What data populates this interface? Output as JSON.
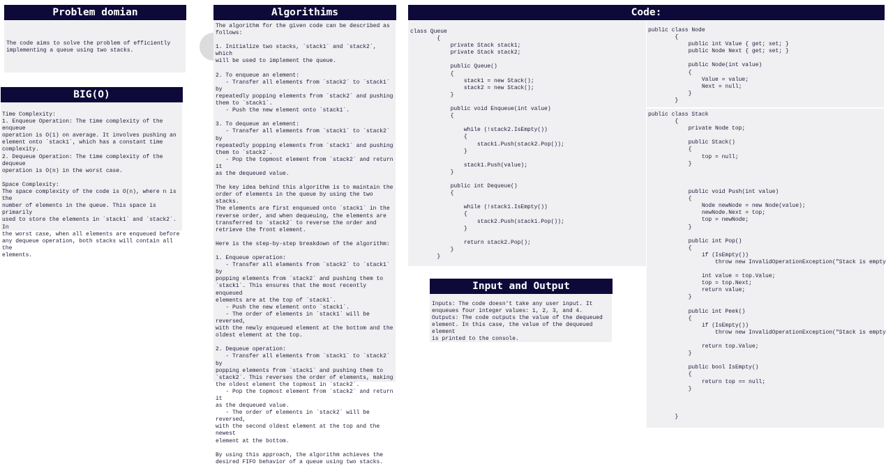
{
  "problem": {
    "title": "Problem domian",
    "body": "The code aims to solve the problem of efficiently\nimplementing a queue using two stacks."
  },
  "bigo": {
    "title": "BIG(O)",
    "body": "Time Complexity:\n1. Enqueue Operation: The time complexity of the enqueue\noperation is O(1) on average. It involves pushing an\nelement onto `stack1`, which has a constant time\ncomplexity.\n2. Dequeue Operation: The time complexity of the dequeue\noperation is O(n) in the worst case.\n\nSpace Complexity:\nThe space complexity of the code is O(n), where n is the\nnumber of elements in the queue. This space is primarily\nused to store the elements in `stack1` and `stack2`. In\nthe worst case, when all elements are enqueued before\nany dequeue operation, both stacks will contain all the\nelements."
  },
  "algorithms": {
    "title": "Algorithims",
    "body": "The algorithm for the given code can be described as\nfollows:\n\n1. Initialize two stacks, `stack1` and `stack2`, which\nwill be used to implement the queue.\n\n2. To enqueue an element:\n   - Transfer all elements from `stack2` to `stack1` by\nrepeatedly popping elements from `stack2` and pushing\nthem to `stack1`.\n   - Push the new element onto `stack1`.\n\n3. To dequeue an element:\n   - Transfer all elements from `stack1` to `stack2` by\nrepeatedly popping elements from `stack1` and pushing\nthem to `stack2`.\n   - Pop the topmost element from `stack2` and return it\nas the dequeued value.\n\nThe key idea behind this algorithm is to maintain the\norder of elements in the queue by using the two stacks.\nThe elements are first enqueued onto `stack1` in the\nreverse order, and when dequeuing, the elements are\ntransferred to `stack2` to reverse the order and\nretrieve the front element.\n\nHere is the step-by-step breakdown of the algorithm:\n\n1. Enqueue operation:\n   - Transfer all elements from `stack2` to `stack1` by\npopping elements from `stack2` and pushing them to\n`stack1`. This ensures that the most recently enqueued\nelements are at the top of `stack1`.\n   - Push the new element onto `stack1`.\n   - The order of elements in `stack1` will be reversed,\nwith the newly enqueued element at the bottom and the\noldest element at the top.\n\n2. Dequeue operation:\n   - Transfer all elements from `stack1` to `stack2` by\npopping elements from `stack1` and pushing them to\n`stack2`. This reverses the order of elements, making\nthe oldest element the topmost in `stack2`.\n   - Pop the topmost element from `stack2` and return it\nas the dequeued value.\n   - The order of elements in `stack2` will be reversed,\nwith the second oldest element at the top and the newest\nelement at the bottom.\n\nBy using this approach, the algorithm achieves the\ndesired FIFO behavior of a queue using two stacks."
  },
  "code": {
    "title": "Code:",
    "queue": "class Queue\n        {\n            private Stack stack1;\n            private Stack stack2;\n\n            public Queue()\n            {\n                stack1 = new Stack();\n                stack2 = new Stack();\n            }\n\n            public void Enqueue(int value)\n            {\n\n                while (!stack2.IsEmpty())\n                {\n                    stack1.Push(stack2.Pop());\n                }\n\n                stack1.Push(value);\n            }\n\n            public int Dequeue()\n            {\n\n                while (!stack1.IsEmpty())\n                {\n                    stack2.Push(stack1.Pop());\n                }\n\n                return stack2.Pop();\n            }\n        }",
    "node": "public class Node\n        {\n            public int Value { get; set; }\n            public Node Next { get; set; }\n\n            public Node(int value)\n            {\n                Value = value;\n                Next = null;\n            }\n        }",
    "stack": "public class Stack\n        {\n            private Node top;\n\n            public Stack()\n            {\n                top = null;\n            }\n\n\n\n            public void Push(int value)\n            {\n                Node newNode = new Node(value);\n                newNode.Next = top;\n                top = newNode;\n            }\n\n            public int Pop()\n            {\n                if (IsEmpty())\n                    throw new InvalidOperationException(\"Stack is empty\");\n\n                int value = top.Value;\n                top = top.Next;\n                return value;\n            }\n\n            public int Peek()\n            {\n                if (IsEmpty())\n                    throw new InvalidOperationException(\"Stack is empty\");\n\n                return top.Value;\n            }\n\n            public bool IsEmpty()\n            {\n                return top == null;\n            }\n\n\n\n        }"
  },
  "io": {
    "title": "Input and Output",
    "body": "Inputs: The code doesn't take any user input. It\nenqueues four integer values: 1, 2, 3, and 4.\nOutputs: The code outputs the value of the dequeued\nelement. In this case, the value of the dequeued element\nis printed to the console."
  }
}
